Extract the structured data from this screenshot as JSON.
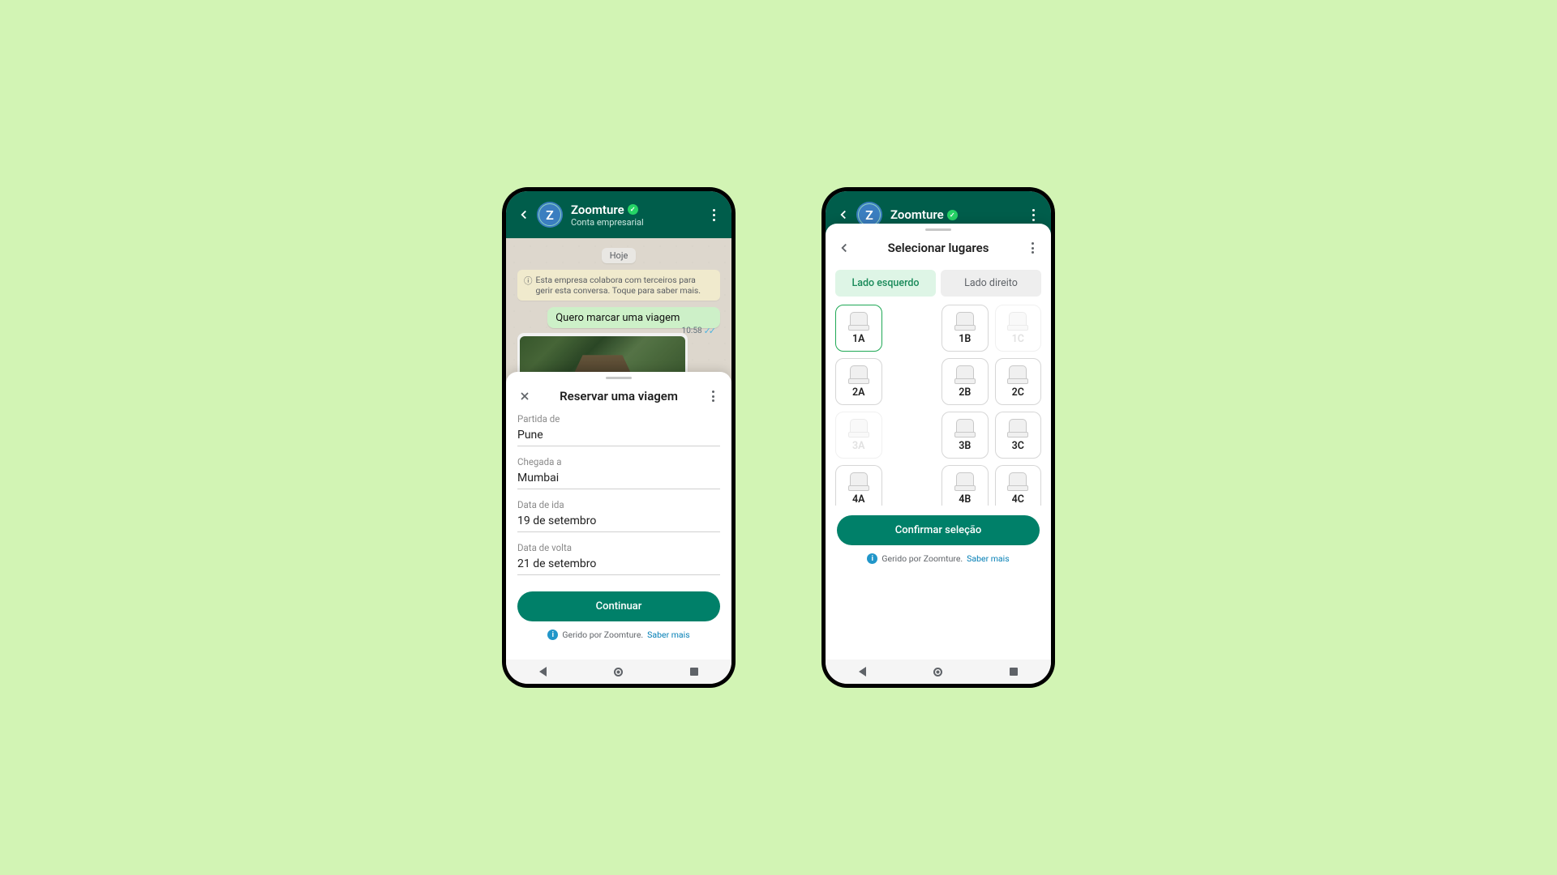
{
  "header": {
    "avatar_letter": "Z",
    "contact_name": "Zoomture",
    "account_type": "Conta empresarial"
  },
  "chat": {
    "date_label": "Hoje",
    "info_notice": "Esta empresa colabora com terceiros para gerir esta conversa. Toque para saber mais.",
    "outgoing_text": "Quero marcar uma viagem",
    "outgoing_time": "10:58"
  },
  "booking_sheet": {
    "title": "Reservar uma viagem",
    "fields": {
      "from_label": "Partida de",
      "from_value": "Pune",
      "to_label": "Chegada a",
      "to_value": "Mumbai",
      "depart_label": "Data de ida",
      "depart_value": "19 de setembro",
      "return_label": "Data de volta",
      "return_value": "21 de setembro"
    },
    "continue_label": "Continuar",
    "managed_text": "Gerido por Zoomture.",
    "learn_more": "Saber mais"
  },
  "seat_sheet": {
    "title": "Selecionar lugares",
    "tab_left": "Lado esquerdo",
    "tab_right": "Lado direito",
    "seats": {
      "r1a": "1A",
      "r1b": "1B",
      "r1c": "1C",
      "r2a": "2A",
      "r2b": "2B",
      "r2c": "2C",
      "r3a": "3A",
      "r3b": "3B",
      "r3c": "3C",
      "r4a": "4A",
      "r4b": "4B",
      "r4c": "4C"
    },
    "confirm_label": "Confirmar seleção",
    "managed_text": "Gerido por Zoomture.",
    "learn_more": "Saber mais"
  }
}
